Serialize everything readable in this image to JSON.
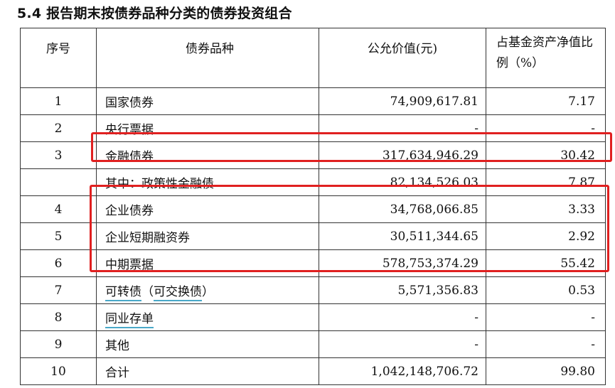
{
  "title": "5.4 报告期末按债券品种分类的债券投资组合",
  "headers": {
    "seq": "序号",
    "type": "债券品种",
    "fair_value": "公允价值(元)",
    "ratio": "占基金资产净值比例（%）"
  },
  "rows": [
    {
      "seq": "1",
      "type": "国家债券",
      "value": "74,909,617.81",
      "ratio": "7.17"
    },
    {
      "seq": "2",
      "type": "央行票据",
      "value": "-",
      "ratio": "-"
    },
    {
      "seq": "3",
      "type": "金融债券",
      "value": "317,634,946.29",
      "ratio": "30.42"
    },
    {
      "seq": "",
      "type": "其中：政策性金融债",
      "value": "82,134,526.03",
      "ratio": "7.87"
    },
    {
      "seq": "4",
      "type": "企业债券",
      "value": "34,768,066.85",
      "ratio": "3.33"
    },
    {
      "seq": "5",
      "type": "企业短期融资券",
      "value": "30,511,344.65",
      "ratio": "2.92"
    },
    {
      "seq": "6",
      "type": "中期票据",
      "value": "578,753,374.29",
      "ratio": "55.42"
    },
    {
      "seq": "7",
      "type_link1": "可转债",
      "type_mid": "（",
      "type_link2": "可交换债",
      "type_end": "）",
      "value": "5,571,356.83",
      "ratio": "0.53"
    },
    {
      "seq": "8",
      "type": "同业存单",
      "value": "-",
      "ratio": "-"
    },
    {
      "seq": "9",
      "type": "其他",
      "value": "-",
      "ratio": "-"
    },
    {
      "seq": "10",
      "type": "合计",
      "value": "1,042,148,706.72",
      "ratio": "99.80"
    }
  ],
  "colors": {
    "highlight": "#e02020",
    "link_underline": "#4aa8c8",
    "border": "#333333"
  }
}
